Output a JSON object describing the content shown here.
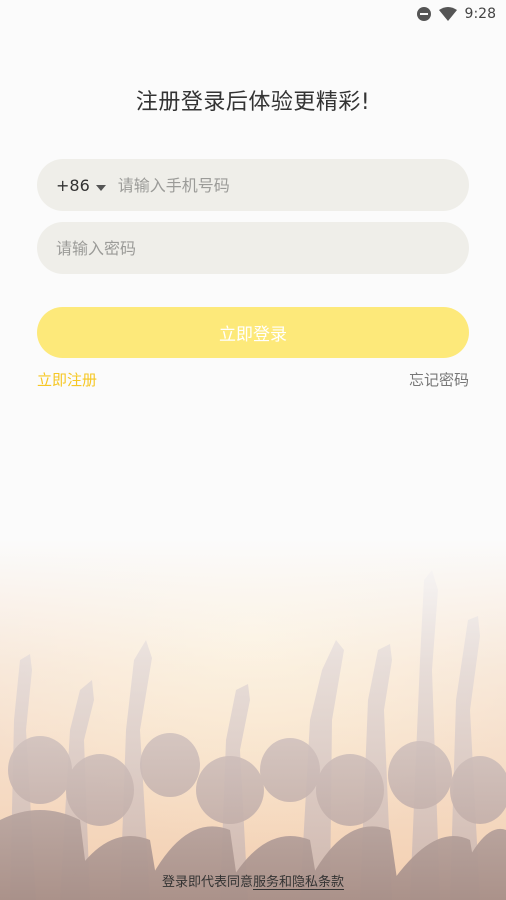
{
  "status_bar": {
    "time": "9:28",
    "icons": [
      "do-not-disturb-icon",
      "wifi-icon"
    ]
  },
  "title": "注册登录后体验更精彩!",
  "phone_field": {
    "country_code": "+86",
    "placeholder": "请输入手机号码",
    "value": ""
  },
  "password_field": {
    "placeholder": "请输入密码",
    "value": ""
  },
  "login_button": "立即登录",
  "register_link": "立即注册",
  "forgot_link": "忘记密码",
  "footer": {
    "prefix": "登录即代表同意",
    "terms": "服务和隐私条款"
  },
  "colors": {
    "accent": "#fde97a",
    "link": "#f6c723",
    "field_bg": "#efeee9"
  }
}
